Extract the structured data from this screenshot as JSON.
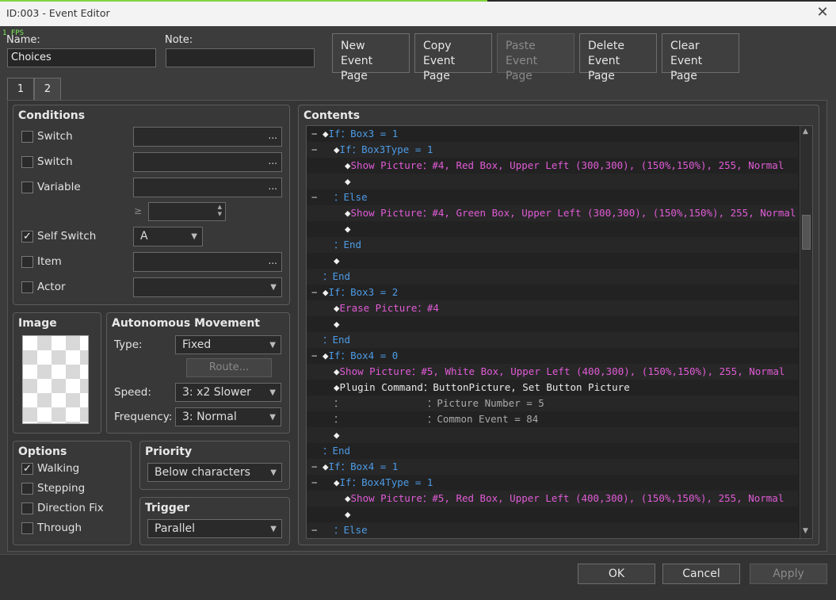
{
  "window": {
    "title": "ID:003 - Event Editor",
    "fps": "1 FPS"
  },
  "fields": {
    "name_label": "Name:",
    "name_value": "Choices",
    "note_label": "Note:",
    "note_value": ""
  },
  "page_buttons": {
    "new_1": "New",
    "new_2": "Event Page",
    "copy_1": "Copy",
    "copy_2": "Event Page",
    "paste_1": "Paste",
    "paste_2": "Event Page",
    "delete_1": "Delete",
    "delete_2": "Event Page",
    "clear_1": "Clear",
    "clear_2": "Event Page"
  },
  "tabs": [
    "1",
    "2"
  ],
  "conditions": {
    "title": "Conditions",
    "switch1": "Switch",
    "switch2": "Switch",
    "variable": "Variable",
    "gte": "≥",
    "self_switch": "Self Switch",
    "self_switch_value": "A",
    "item": "Item",
    "actor": "Actor",
    "ellipsis": "..."
  },
  "image": {
    "title": "Image"
  },
  "movement": {
    "title": "Autonomous Movement",
    "type_label": "Type:",
    "type_value": "Fixed",
    "route": "Route...",
    "speed_label": "Speed:",
    "speed_value": "3: x2 Slower",
    "frequency_label": "Frequency:",
    "frequency_value": "3: Normal"
  },
  "options": {
    "title": "Options",
    "walking": "Walking",
    "stepping": "Stepping",
    "direction_fix": "Direction Fix",
    "through": "Through"
  },
  "priority": {
    "title": "Priority",
    "value": "Below characters"
  },
  "trigger": {
    "title": "Trigger",
    "value": "Parallel"
  },
  "contents": {
    "title": "Contents",
    "rows": [
      {
        "fold": "−",
        "indent": 0,
        "dia": "◆",
        "a": "If",
        "ac": "c-blue",
        "b": "：Box3 = 1",
        "bc": "c-blue"
      },
      {
        "fold": "−",
        "indent": 1,
        "dia": "◆",
        "a": "If",
        "ac": "c-blue",
        "b": "：Box3Type = 1",
        "bc": "c-blue"
      },
      {
        "fold": "",
        "indent": 2,
        "dia": "◆",
        "a": "Show Picture",
        "ac": "c-mag",
        "b": "：#4, Red Box, Upper Left (300,300), (150%,150%), 255, Normal",
        "bc": "c-mag"
      },
      {
        "fold": "",
        "indent": 2,
        "dia": "◆",
        "a": "",
        "ac": "",
        "b": "",
        "bc": ""
      },
      {
        "fold": "−",
        "indent": 1,
        "dia": "",
        "a": "：Else",
        "ac": "c-blue",
        "b": "",
        "bc": ""
      },
      {
        "fold": "",
        "indent": 2,
        "dia": "◆",
        "a": "Show Picture",
        "ac": "c-mag",
        "b": "：#4, Green Box, Upper Left (300,300), (150%,150%), 255, Normal",
        "bc": "c-mag"
      },
      {
        "fold": "",
        "indent": 2,
        "dia": "◆",
        "a": "",
        "ac": "",
        "b": "",
        "bc": ""
      },
      {
        "fold": "",
        "indent": 1,
        "dia": "",
        "a": "：End",
        "ac": "c-blue",
        "b": "",
        "bc": ""
      },
      {
        "fold": "",
        "indent": 1,
        "dia": "◆",
        "a": "",
        "ac": "",
        "b": "",
        "bc": ""
      },
      {
        "fold": "",
        "indent": 0,
        "dia": "",
        "a": "：End",
        "ac": "c-blue",
        "b": "",
        "bc": ""
      },
      {
        "fold": "−",
        "indent": 0,
        "dia": "◆",
        "a": "If",
        "ac": "c-blue",
        "b": "：Box3 = 2",
        "bc": "c-blue"
      },
      {
        "fold": "",
        "indent": 1,
        "dia": "◆",
        "a": "Erase Picture",
        "ac": "c-mag",
        "b": "：#4",
        "bc": "c-mag"
      },
      {
        "fold": "",
        "indent": 1,
        "dia": "◆",
        "a": "",
        "ac": "",
        "b": "",
        "bc": ""
      },
      {
        "fold": "",
        "indent": 0,
        "dia": "",
        "a": "：End",
        "ac": "c-blue",
        "b": "",
        "bc": ""
      },
      {
        "fold": "−",
        "indent": 0,
        "dia": "◆",
        "a": "If",
        "ac": "c-blue",
        "b": "：Box4 = 0",
        "bc": "c-blue"
      },
      {
        "fold": "",
        "indent": 1,
        "dia": "◆",
        "a": "Show Picture",
        "ac": "c-mag",
        "b": "：#5, White Box, Upper Left (400,300), (150%,150%), 255, Normal",
        "bc": "c-mag"
      },
      {
        "fold": "",
        "indent": 1,
        "dia": "◆",
        "a": "Plugin Command",
        "ac": "c-white",
        "b": "：ButtonPicture, Set Button Picture",
        "bc": "c-white"
      },
      {
        "fold": "",
        "indent": 1,
        "dia": "",
        "a": "：              ",
        "ac": "c-gray",
        "b": "：Picture Number = 5",
        "bc": "c-gray"
      },
      {
        "fold": "",
        "indent": 1,
        "dia": "",
        "a": "：              ",
        "ac": "c-gray",
        "b": "：Common Event = 84",
        "bc": "c-gray"
      },
      {
        "fold": "",
        "indent": 1,
        "dia": "◆",
        "a": "",
        "ac": "",
        "b": "",
        "bc": ""
      },
      {
        "fold": "",
        "indent": 0,
        "dia": "",
        "a": "：End",
        "ac": "c-blue",
        "b": "",
        "bc": ""
      },
      {
        "fold": "−",
        "indent": 0,
        "dia": "◆",
        "a": "If",
        "ac": "c-blue",
        "b": "：Box4 = 1",
        "bc": "c-blue"
      },
      {
        "fold": "−",
        "indent": 1,
        "dia": "◆",
        "a": "If",
        "ac": "c-blue",
        "b": "：Box4Type = 1",
        "bc": "c-blue"
      },
      {
        "fold": "",
        "indent": 2,
        "dia": "◆",
        "a": "Show Picture",
        "ac": "c-mag",
        "b": "：#5, Red Box, Upper Left (400,300), (150%,150%), 255, Normal",
        "bc": "c-mag"
      },
      {
        "fold": "",
        "indent": 2,
        "dia": "◆",
        "a": "",
        "ac": "",
        "b": "",
        "bc": ""
      },
      {
        "fold": "−",
        "indent": 1,
        "dia": "",
        "a": "：Else",
        "ac": "c-blue",
        "b": "",
        "bc": ""
      }
    ]
  },
  "footer": {
    "ok": "OK",
    "cancel": "Cancel",
    "apply": "Apply"
  },
  "icons": {
    "close": "close-icon",
    "check": "check-icon",
    "dropdown": "chevron-down-icon",
    "spinner": "spinner-arrows-icon",
    "scroll_up": "scroll-up-icon",
    "scroll_down": "scroll-down-icon"
  }
}
